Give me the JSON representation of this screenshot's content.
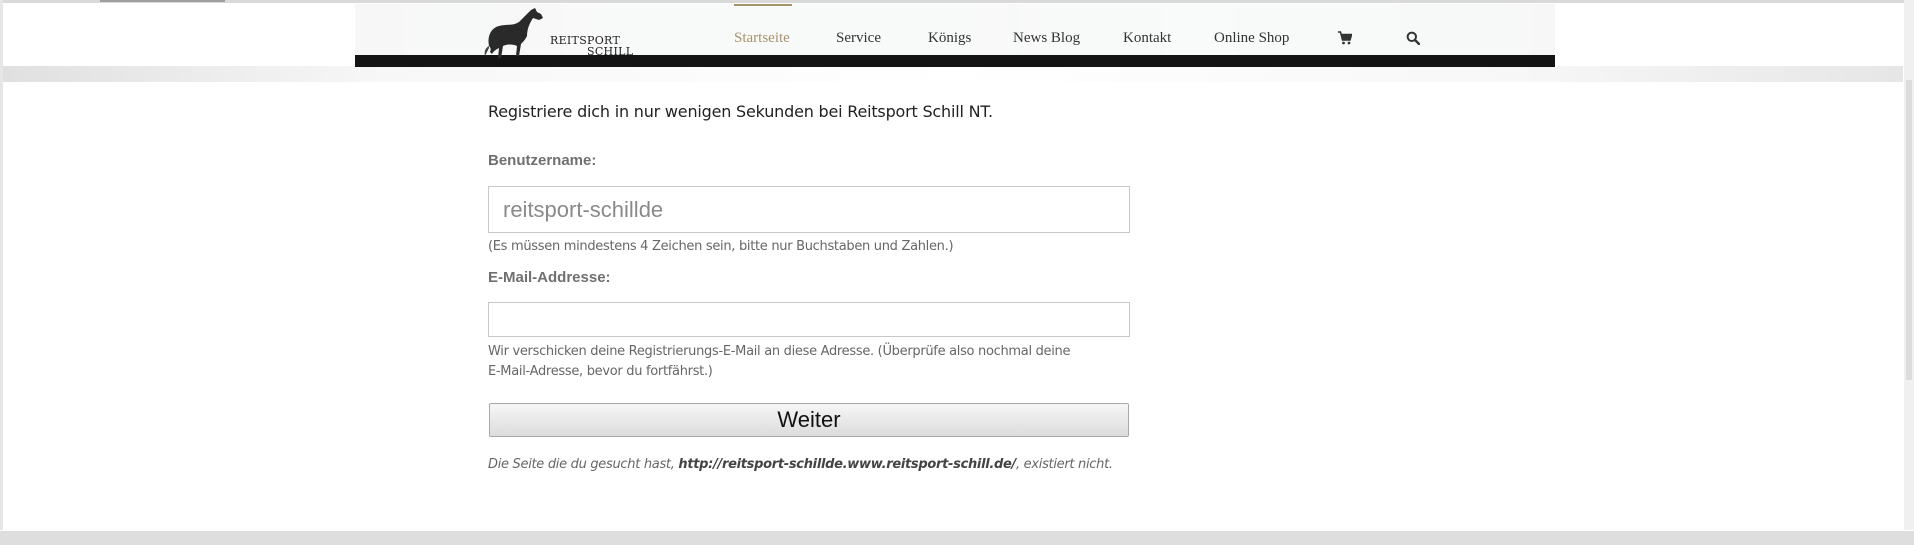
{
  "header": {
    "logo": {
      "line1": "REITSPORT",
      "line2": "SCHILL"
    },
    "nav": [
      {
        "label": "Startseite",
        "active": true
      },
      {
        "label": "Service"
      },
      {
        "label": "Königs"
      },
      {
        "label": "News Blog"
      },
      {
        "label": "Kontakt"
      },
      {
        "label": "Online Shop"
      }
    ],
    "icons": {
      "cart": "shopping-cart-icon",
      "search": "search-icon"
    },
    "accent_color": "#a8926b"
  },
  "form": {
    "intro": "Registriere dich in nur wenigen Sekunden bei Reitsport Schill NT.",
    "username": {
      "label": "Benutzername:",
      "value": "reitsport-schillde",
      "help": "(Es müssen mindestens 4 Zeichen sein, bitte nur Buchstaben und Zahlen.)"
    },
    "email": {
      "label": "E-Mail-Addresse:",
      "value": "",
      "help_line1": "Wir verschicken deine Registrierungs-E-Mail an diese Adresse. (Überprüfe also nochmal deine",
      "help_line2": "E-Mail-Adresse, bevor du fortfährst.)"
    },
    "submit_label": "Weiter"
  },
  "notice": {
    "prefix": "Die Seite die du gesucht hast, ",
    "url": "http://reitsport-schillde.www.reitsport-schill.de/",
    "suffix": ", existiert nicht."
  }
}
